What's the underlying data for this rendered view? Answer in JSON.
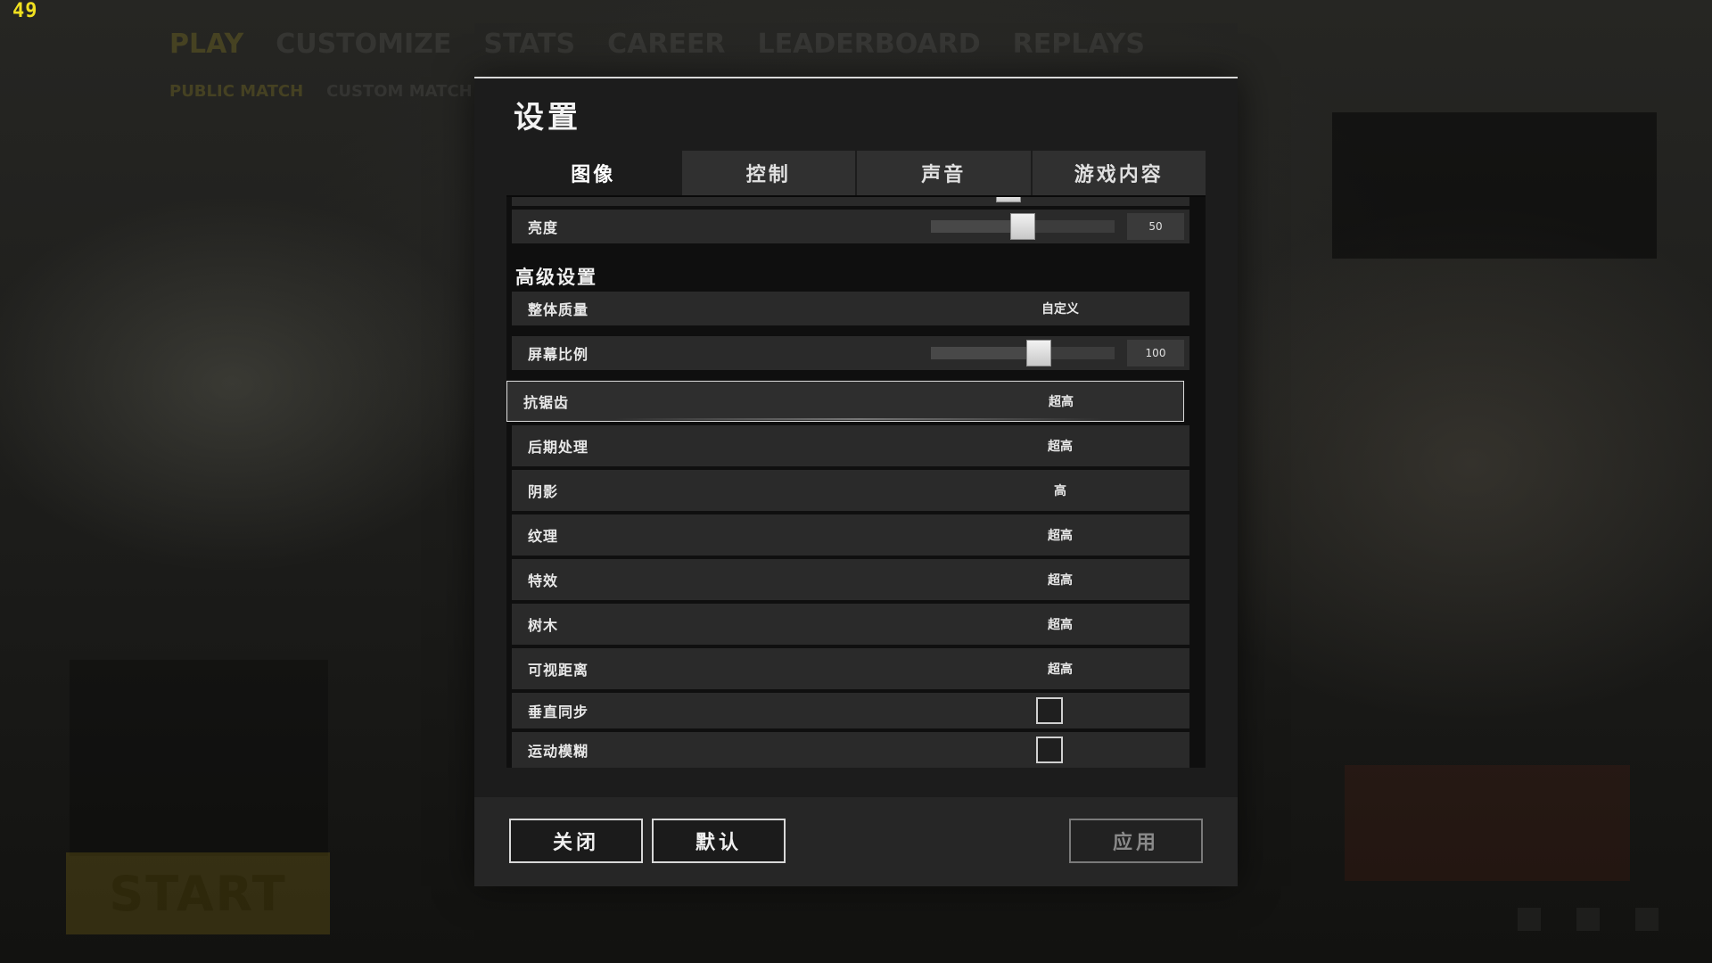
{
  "fps": "49",
  "background": {
    "nav": [
      "PLAY",
      "CUSTOMIZE",
      "STATS",
      "CAREER",
      "LEADERBOARD",
      "REPLAYS"
    ],
    "sub_nav": [
      "PUBLIC MATCH",
      "CUSTOM MATCH"
    ],
    "start_label": "START"
  },
  "settings": {
    "title": "设置",
    "tabs": [
      {
        "label": "图像",
        "active": true
      },
      {
        "label": "控制",
        "active": false
      },
      {
        "label": "声音",
        "active": false
      },
      {
        "label": "游戏内容",
        "active": false
      }
    ],
    "brightness": {
      "label": "亮度",
      "value": "50",
      "fraction": 0.5
    },
    "advanced_heading": "高级设置",
    "overall_quality": {
      "label": "整体质量",
      "value": "自定义"
    },
    "screen_scale": {
      "label": "屏幕比例",
      "value": "100",
      "fraction": 0.6
    },
    "anti_aliasing": {
      "label": "抗锯齿",
      "value": "超高"
    },
    "post_processing": {
      "label": "后期处理",
      "value": "超高"
    },
    "shadows": {
      "label": "阴影",
      "value": "高"
    },
    "textures": {
      "label": "纹理",
      "value": "超高"
    },
    "effects": {
      "label": "特效",
      "value": "超高"
    },
    "foliage": {
      "label": "树木",
      "value": "超高"
    },
    "view_distance": {
      "label": "可视距离",
      "value": "超高"
    },
    "vsync": {
      "label": "垂直同步",
      "checked": false
    },
    "motion_blur": {
      "label": "运动模糊",
      "checked": false
    },
    "buttons": {
      "close": "关闭",
      "default": "默认",
      "apply": "应用"
    }
  }
}
